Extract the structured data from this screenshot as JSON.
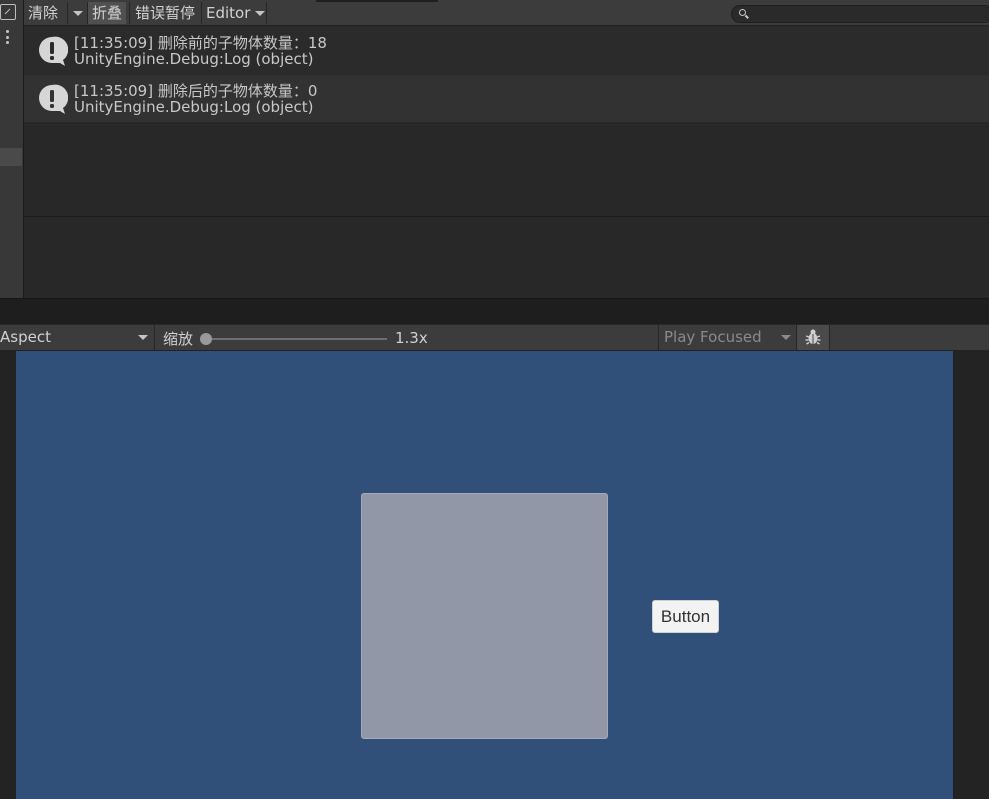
{
  "console": {
    "toolbar": {
      "clear_label": "清除",
      "collapse_label": "折叠",
      "error_pause_label": "错误暂停",
      "editor_label": "Editor",
      "search": {
        "placeholder": "",
        "value": ""
      }
    },
    "logs": [
      {
        "line1": "[11:35:09] 删除前的子物体数量：18",
        "line2": "UnityEngine.Debug:Log (object)",
        "icon": "warning-icon"
      },
      {
        "line1": "[11:35:09] 删除后的子物体数量：0",
        "line2": "UnityEngine.Debug:Log (object)",
        "icon": "warning-icon"
      }
    ]
  },
  "game_view": {
    "toolbar": {
      "aspect_label": "Aspect",
      "zoom_label": "缩放",
      "zoom_value": "1.3x",
      "zoom_fraction": 0.0,
      "play_mode_label": "Play Focused",
      "bug_icon": "bug-icon"
    },
    "scene": {
      "button_label": "Button"
    }
  },
  "colors": {
    "game_background": "#304f79",
    "panel_image": "#9197a6",
    "editor_dark": "#282828",
    "toolbar": "#3c3c3c"
  }
}
